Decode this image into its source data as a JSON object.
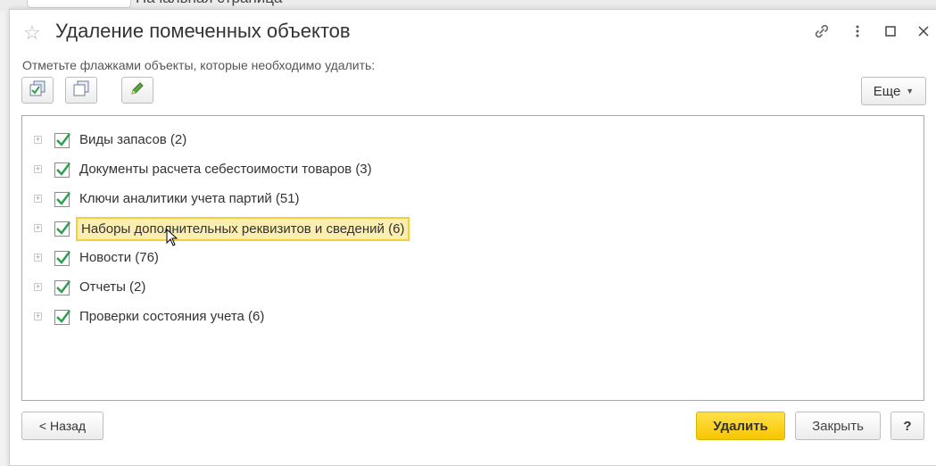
{
  "background": {
    "tab_title": "Начальная страница"
  },
  "window": {
    "title": "Удаление помеченных объектов",
    "hint": "Отметьте флажками объекты, которые необходимо удалить:"
  },
  "toolbar": {
    "more_label": "Еще"
  },
  "items": [
    {
      "label": "Виды запасов (2)",
      "checked": true,
      "selected": false
    },
    {
      "label": "Документы расчета себестоимости товаров (3)",
      "checked": true,
      "selected": false
    },
    {
      "label": "Ключи аналитики учета партий (51)",
      "checked": true,
      "selected": false
    },
    {
      "label": "Наборы дополнительных реквизитов и сведений (6)",
      "checked": true,
      "selected": true
    },
    {
      "label": "Новости (76)",
      "checked": true,
      "selected": false
    },
    {
      "label": "Отчеты (2)",
      "checked": true,
      "selected": false
    },
    {
      "label": "Проверки состояния учета (6)",
      "checked": true,
      "selected": false
    }
  ],
  "buttons": {
    "back": "< Назад",
    "delete": "Удалить",
    "close": "Закрыть",
    "help": "?"
  },
  "colors": {
    "check_green": "#2e9e4f",
    "delete_yellow": "#f7c600",
    "selection_yellow": "#fbeeb0"
  }
}
